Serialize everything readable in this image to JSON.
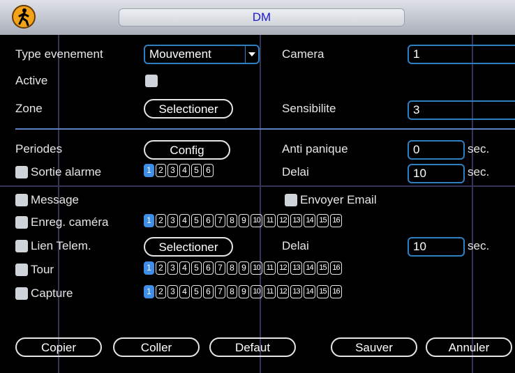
{
  "title": "DM",
  "fields": {
    "type_evenement_label": "Type evenement",
    "type_evenement_value": "Mouvement",
    "camera_label": "Camera",
    "camera_value": "1",
    "active_label": "Active",
    "zone_label": "Zone",
    "zone_button": "Selectioner",
    "sensibilite_label": "Sensibilite",
    "sensibilite_value": "3",
    "periodes_label": "Periodes",
    "config_button": "Config",
    "anti_panique_label": "Anti panique",
    "anti_panique_value": "0",
    "sec_1": "sec.",
    "sortie_alarme_label": "Sortie alarme",
    "delai_label": "Delai",
    "delai_value": "10",
    "sec_2": "sec.",
    "message_label": "Message",
    "envoyer_email_label": "Envoyer Email",
    "enreg_camera_label": "Enreg. caméra",
    "lien_telem_label": "Lien Telem.",
    "lien_button": "Selectioner",
    "delai2_label": "Delai",
    "delai2_value": "10",
    "sec_3": "sec.",
    "tour_label": "Tour",
    "capture_label": "Capture"
  },
  "alarm_outputs": [
    "1",
    "2",
    "3",
    "4",
    "5",
    "6"
  ],
  "channels": [
    "1",
    "2",
    "3",
    "4",
    "5",
    "6",
    "7",
    "8",
    "9",
    "10",
    "11",
    "12",
    "13",
    "14",
    "15",
    "16"
  ],
  "buttons": {
    "copier": "Copier",
    "coller": "Coller",
    "defaut": "Defaut",
    "sauver": "Sauver",
    "annuler": "Annuler"
  }
}
